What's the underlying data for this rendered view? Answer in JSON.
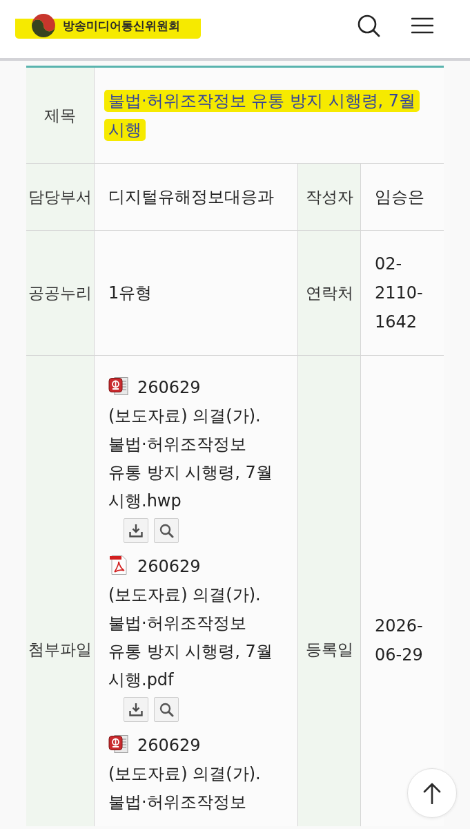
{
  "header": {
    "logo": {
      "text": "방송미디어통신위원회",
      "highlighted": true
    }
  },
  "detail": {
    "title": {
      "label": "제목",
      "value": "불법·허위조작정보 유통 방지 시행령, 7월 시행",
      "highlighted": true
    },
    "rows": [
      {
        "cells": [
          {
            "label": "담당부서",
            "kind": "text",
            "value": "디지털유해정보대응과"
          },
          {
            "label": "작성자",
            "kind": "text",
            "value": "임승은"
          }
        ]
      },
      {
        "cells": [
          {
            "label": "공공누리",
            "kind": "text",
            "value": "1유형"
          },
          {
            "label": "연락처",
            "kind": "text",
            "value": "02-2110-1642"
          }
        ]
      },
      {
        "cells": [
          {
            "label": "첨부파일",
            "kind": "files",
            "files": [
              {
                "kind": "hwp",
                "name": "260629 (보도자료) 의결(가). 불법·허위조작정보 유통 방지 시행령, 7월 시행.hwp",
                "show_actions": true
              },
              {
                "kind": "pdf",
                "name": "260629 (보도자료) 의결(가). 불법·허위조작정보 유통 방지 시행령, 7월 시행.pdf",
                "show_actions": true
              },
              {
                "kind": "hwp",
                "name": "260629 (보도자료) 의결(가). 불법·허위조작정보",
                "show_actions": false
              }
            ]
          },
          {
            "label": "등록일",
            "kind": "text",
            "value": "2026-06-29"
          }
        ]
      }
    ]
  }
}
